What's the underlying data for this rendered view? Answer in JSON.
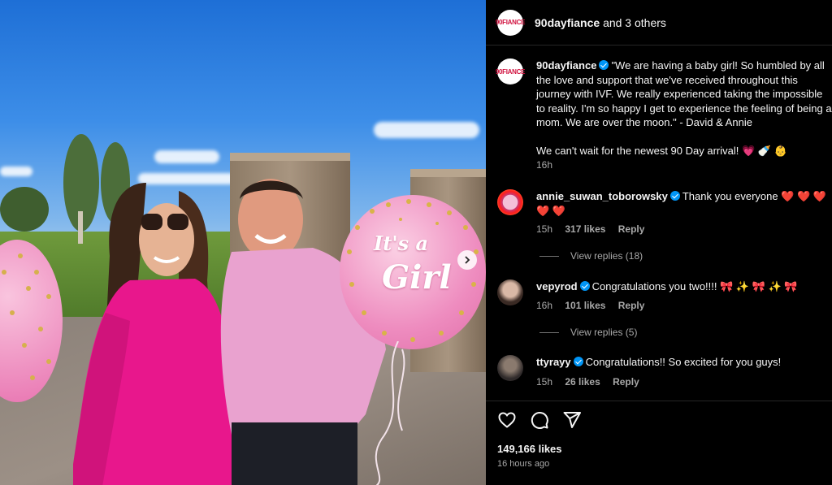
{
  "header": {
    "account": "90dayfiance",
    "others": "and 3 others",
    "logo_text": "90FIANCE"
  },
  "caption": {
    "username": "90dayfiance",
    "text": "\"We are having a baby girl! So humbled by all the love and support that we've received throughout this journey with IVF. We really experienced taking the impossible to reality. I'm so happy I get to experience the feeling of being a mom. We are over the moon.\" - David & Annie\n\nWe can't wait for the newest 90 Day arrival! 💗 🍼 👶",
    "time": "16h"
  },
  "comments": [
    {
      "username": "annie_suwan_toborowsky",
      "text": "Thank you everyone ❤️ ❤️ ❤️ ❤️ ❤️",
      "time": "15h",
      "likes": "317 likes",
      "reply": "Reply",
      "view_replies": "View replies (18)"
    },
    {
      "username": "vepyrod",
      "text": "Congratulations you two!!!! 🎀 ✨ 🎀 ✨ 🎀",
      "time": "16h",
      "likes": "101 likes",
      "reply": "Reply",
      "view_replies": "View replies (5)"
    },
    {
      "username": "ttyrayy",
      "text": "Congratulations!! So excited for you guys!",
      "time": "15h",
      "likes": "26 likes",
      "reply": "Reply"
    }
  ],
  "balloon_text": {
    "line1": "It's a",
    "line2": "Girl"
  },
  "post": {
    "likes": "149,166 likes",
    "posted": "16 hours ago"
  },
  "icons": {
    "like": "heart-icon",
    "comment": "comment-icon",
    "share": "share-icon",
    "next": "chevron-right-icon"
  },
  "colors": {
    "background": "#000000",
    "verified": "#0095f6",
    "muted": "#a8a8a8",
    "brand": "#d1123f"
  }
}
